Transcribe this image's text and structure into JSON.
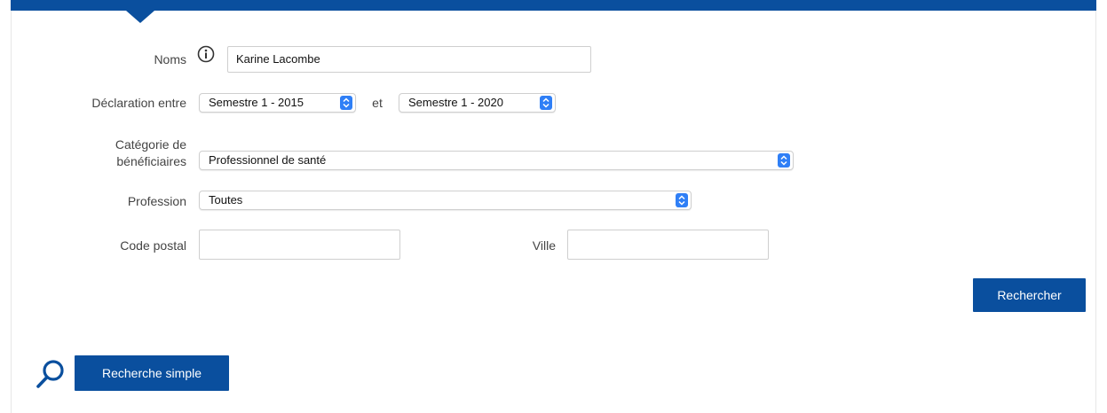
{
  "form": {
    "noms": {
      "label": "Noms",
      "value": "Karine Lacombe"
    },
    "declaration": {
      "label": "Déclaration entre",
      "from": "Semestre 1 - 2015",
      "separator": "et",
      "to": "Semestre 1 - 2020"
    },
    "categorie": {
      "label_line1": "Catégorie de",
      "label_line2": "bénéficiaires",
      "value": "Professionnel de santé"
    },
    "profession": {
      "label": "Profession",
      "value": "Toutes"
    },
    "code_postal": {
      "label": "Code postal",
      "value": ""
    },
    "ville": {
      "label": "Ville",
      "value": ""
    },
    "submit_label": "Rechercher"
  },
  "footer": {
    "simple_search_label": "Recherche simple"
  },
  "icons": {
    "info": "info-icon",
    "select_arrows": "chevron-updown-icon",
    "search": "search-icon"
  },
  "colors": {
    "brand_blue": "#0a4f9e",
    "select_accent": "#2f7ff6"
  }
}
